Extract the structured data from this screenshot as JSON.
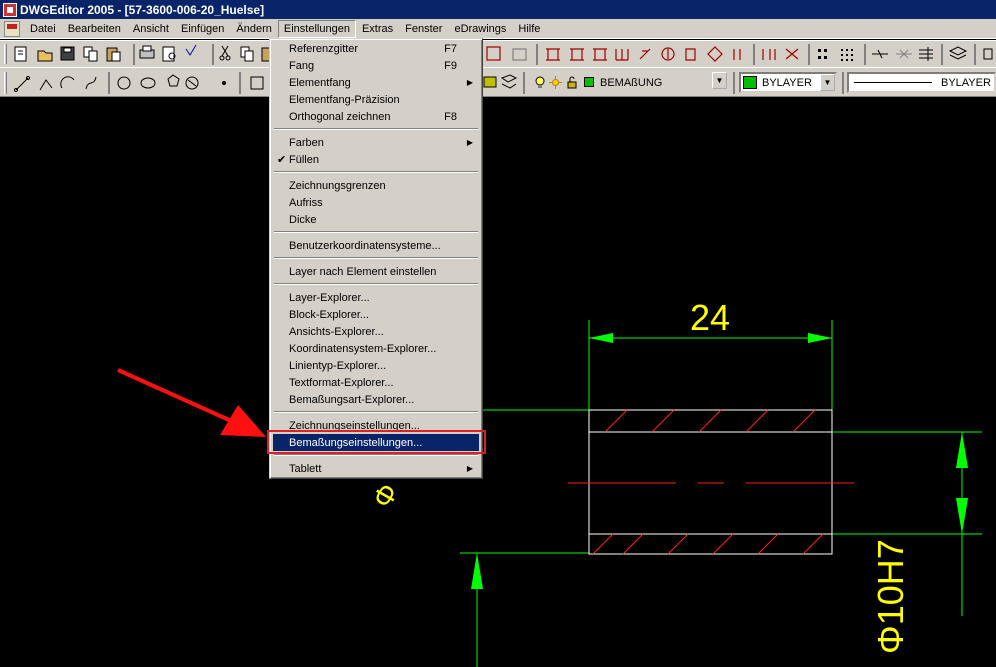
{
  "window": {
    "title": "DWGEditor 2005 - [57-3600-006-20_Huelse]"
  },
  "menubar": [
    {
      "label": "Datei",
      "active": false
    },
    {
      "label": "Bearbeiten",
      "active": false
    },
    {
      "label": "Ansicht",
      "active": false
    },
    {
      "label": "Einfügen",
      "active": false
    },
    {
      "label": "Ändern",
      "active": false
    },
    {
      "label": "Einstellungen",
      "active": true
    },
    {
      "label": "Extras",
      "active": false
    },
    {
      "label": "Fenster",
      "active": false
    },
    {
      "label": "eDrawings",
      "active": false
    },
    {
      "label": "Hilfe",
      "active": false
    }
  ],
  "toolbar": {
    "layer_combo": "BEMAßUNG",
    "color_combo": "BYLAYER",
    "linetype_combo": "BYLAYER",
    "colors": {
      "layer_swatch": "#00c000",
      "color_swatch": "#00c000"
    }
  },
  "menu": {
    "items": [
      {
        "label": "Referenzgitter",
        "shortcut": "F7"
      },
      {
        "label": "Fang",
        "shortcut": "F9"
      },
      {
        "label": "Elementfang",
        "submenu": true
      },
      {
        "label": "Elementfang-Präzision"
      },
      {
        "label": "Orthogonal zeichnen",
        "shortcut": "F8"
      },
      {
        "label": "Farben",
        "submenu": true
      },
      {
        "label": "Füllen",
        "checked": true
      },
      {
        "label": "Zeichnungsgrenzen"
      },
      {
        "label": "Aufriss"
      },
      {
        "label": "Dicke"
      },
      {
        "label": "Benutzerkoordinatensysteme..."
      },
      {
        "label": "Layer nach Element einstellen"
      },
      {
        "label": "Layer-Explorer..."
      },
      {
        "label": "Block-Explorer..."
      },
      {
        "label": "Ansichts-Explorer..."
      },
      {
        "label": "Koordinatensystem-Explorer..."
      },
      {
        "label": "Linientyp-Explorer..."
      },
      {
        "label": "Textformat-Explorer..."
      },
      {
        "label": "Bemaßungsart-Explorer..."
      },
      {
        "label": "Zeichnungseinstellungen..."
      },
      {
        "label": "Bemaßungseinstellungen...",
        "highlighted": true
      },
      {
        "label": "Tablett",
        "submenu": true
      }
    ],
    "check_glyph": "✔",
    "submenu_glyph": "▶"
  },
  "drawing": {
    "dim_top": "24",
    "dim_side": "Φ10H7",
    "dim_left": "Φ",
    "colors": {
      "dim": "#00ff00",
      "dim_text": "#ffff00",
      "part": "#ffffff",
      "hatch": "#ff2020",
      "arrow": "#ff1010"
    }
  }
}
